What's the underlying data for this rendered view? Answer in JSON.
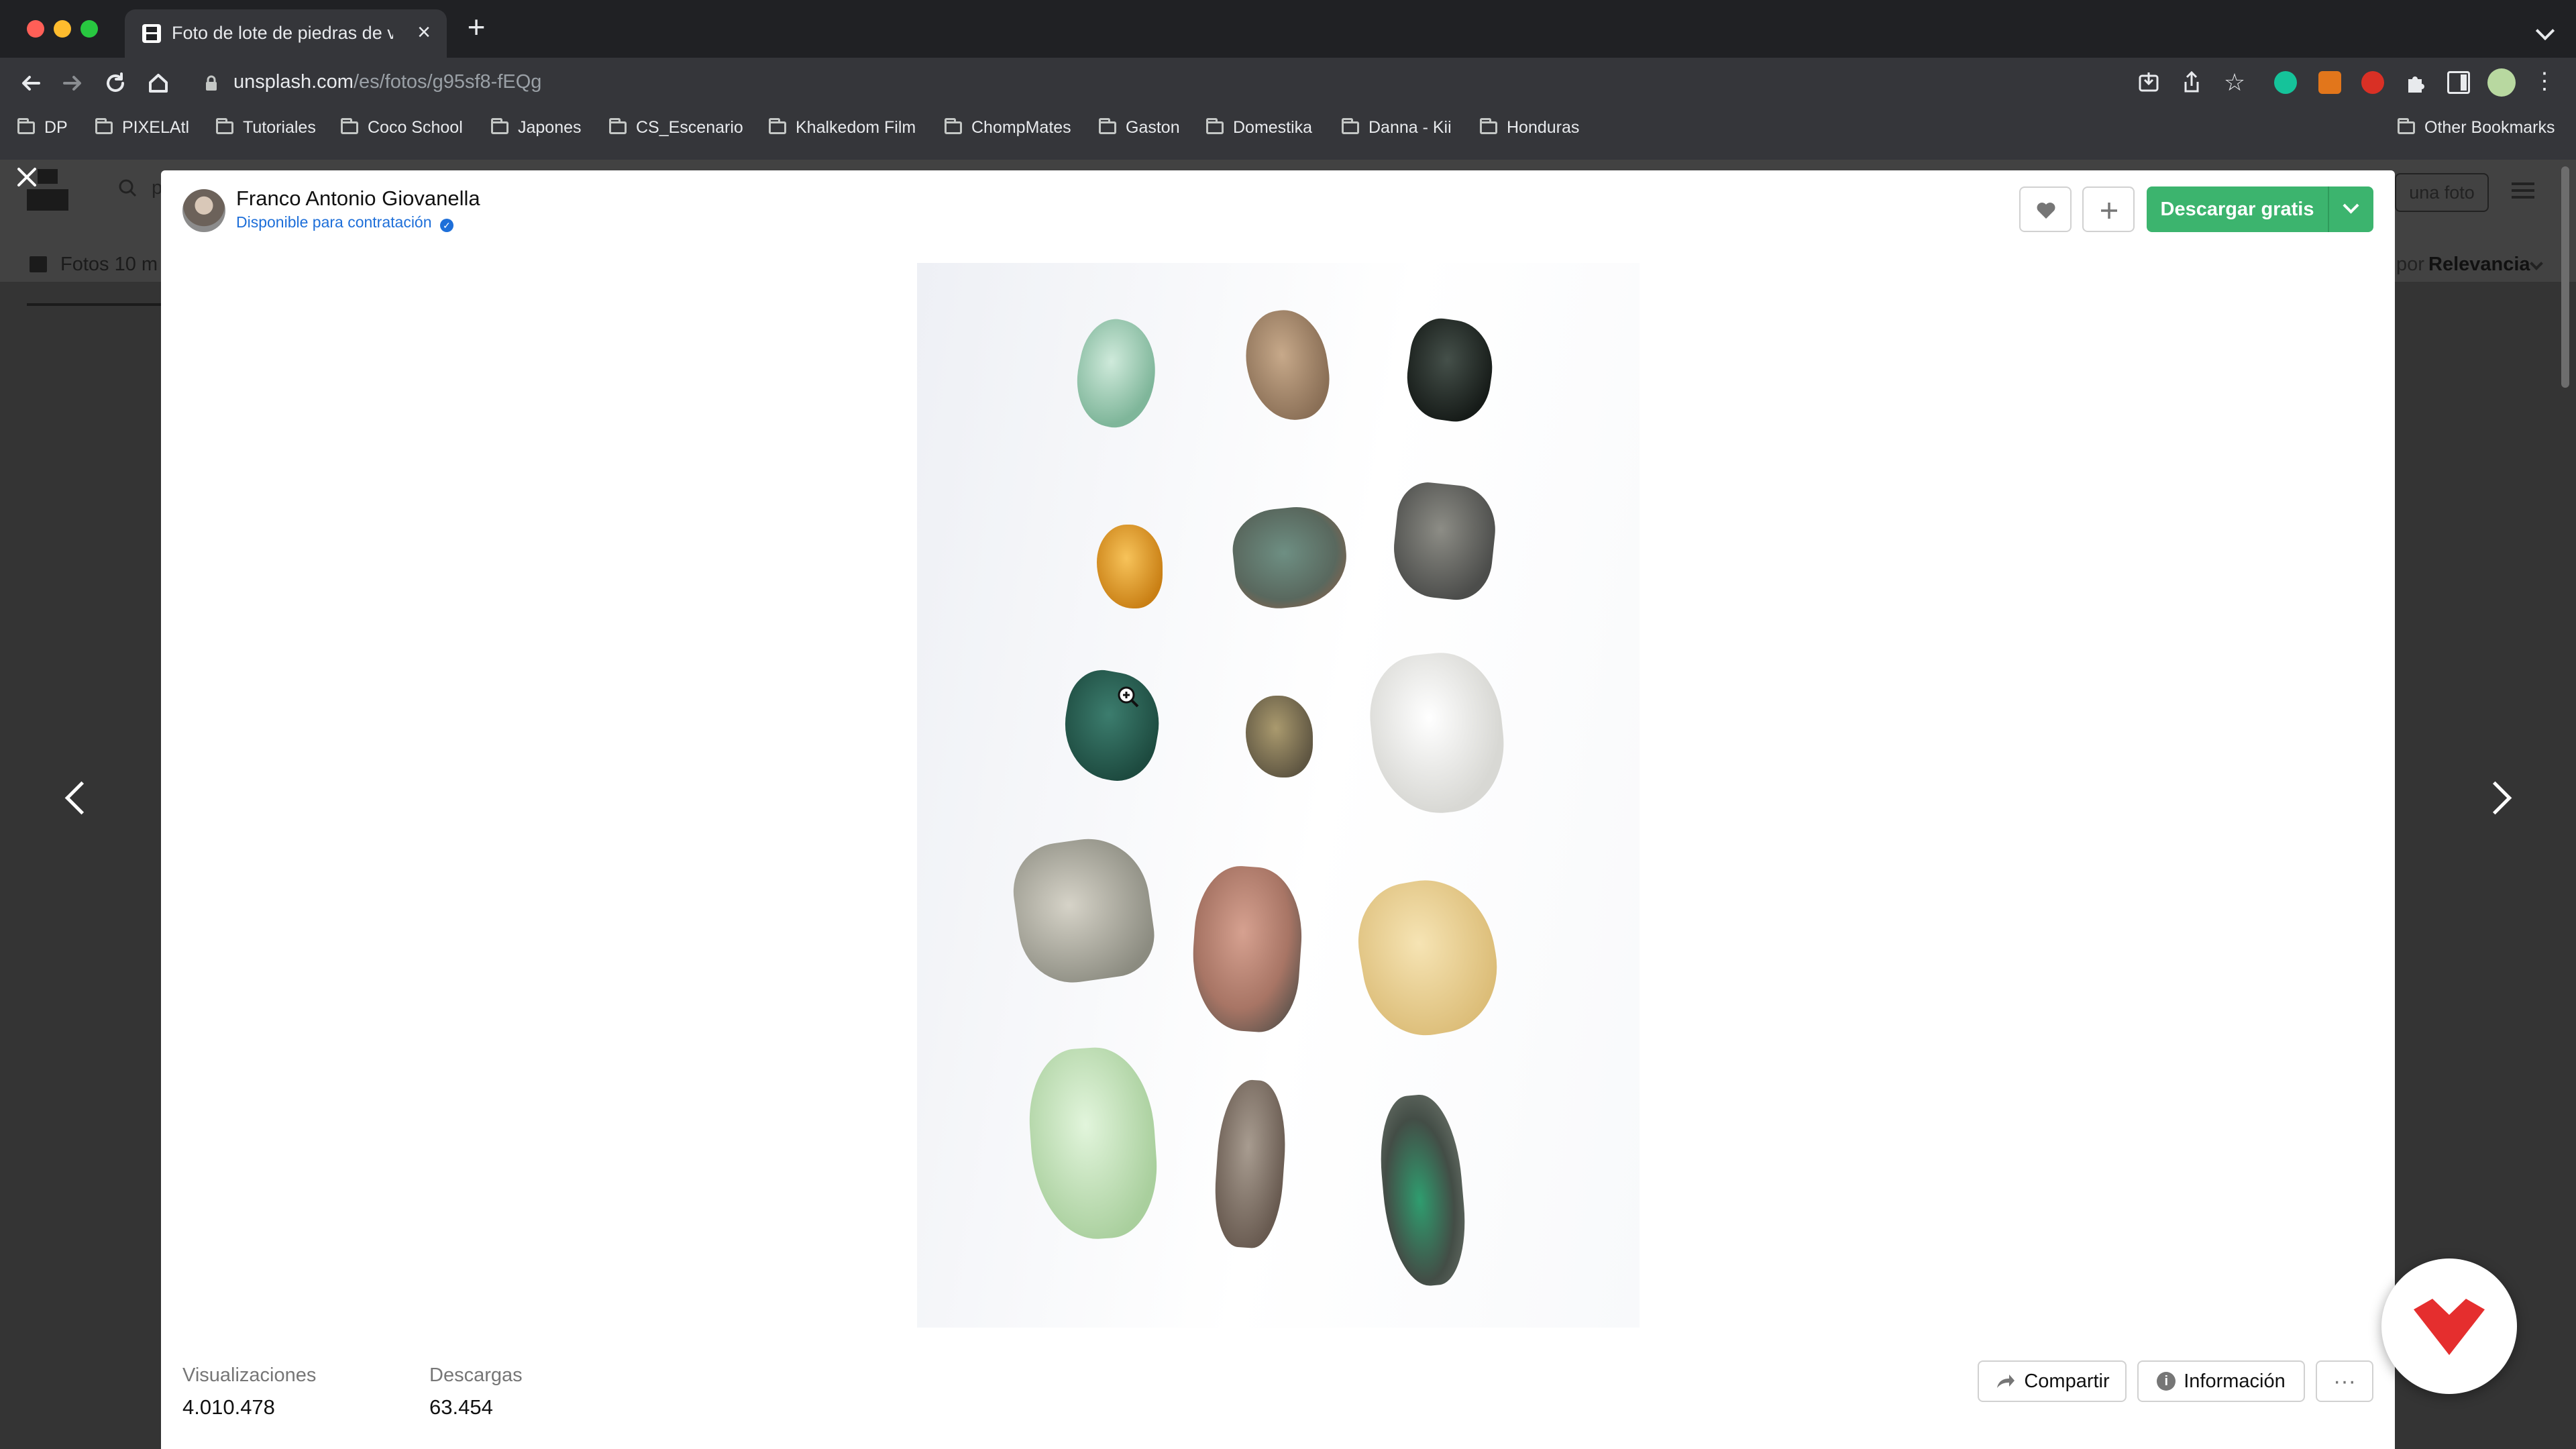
{
  "browser": {
    "tab_title": "Foto de lote de piedras de vario",
    "url_domain": "unsplash.com",
    "url_path": "/es/fotos/g95sf8-fEQg",
    "bookmarks": [
      "DP",
      "PIXELAtl",
      "Tutoriales",
      "Coco School",
      "Japones",
      "CS_Escenario",
      "Khalkedom Film",
      "ChompMates",
      "Gaston",
      "Domestika",
      "Danna - Kii",
      "Honduras"
    ],
    "other_bookmarks": "Other Bookmarks",
    "colors": {
      "frame": "#202124",
      "toolbar": "#35363a"
    }
  },
  "background_page": {
    "search_placeholder_partial": "p",
    "photos_tab": "Fotos 10 m",
    "submit_partial": "una foto",
    "sort_prefix": "por",
    "sort_value": "Relevancia"
  },
  "modal": {
    "author_name": "Franco Antonio Giovanella",
    "author_status": "Disponible para contratación",
    "download_label": "Descargar gratis",
    "stats": [
      {
        "label": "Visualizaciones",
        "value": "4.010.478"
      },
      {
        "label": "Descargas",
        "value": "63.454"
      }
    ],
    "share_label": "Compartir",
    "info_label": "Información",
    "more_label": "···",
    "colors": {
      "download": "#3cb46e",
      "verified": "#1e6fd9",
      "domestika": "#e52e2e"
    }
  },
  "icons": [
    "close-icon",
    "chevron-left-icon",
    "chevron-right-icon",
    "heart-icon",
    "plus-icon",
    "chevron-down-icon",
    "share-icon",
    "info-icon",
    "zoom-icon",
    "domestika-logo-icon"
  ]
}
